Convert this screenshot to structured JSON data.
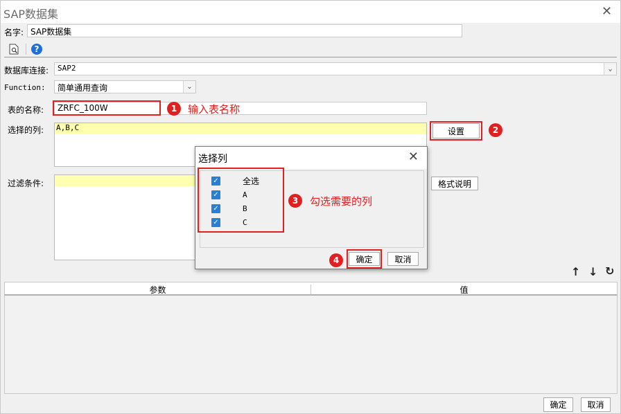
{
  "window": {
    "title": "SAP数据集"
  },
  "name_row": {
    "label": "名字:",
    "value": "SAP数据集"
  },
  "toolbar": {
    "preview_icon": "preview-icon",
    "help_icon": "help-icon"
  },
  "db_connection": {
    "label": "数据库连接:",
    "value": "SAP2"
  },
  "function": {
    "label": "Function:",
    "value": "简单通用查询"
  },
  "table_name": {
    "label": "表的名称:",
    "value": "ZRFC_100W"
  },
  "selected_columns": {
    "label": "选择的列:",
    "value": "A,B,C",
    "settings_button": "设置"
  },
  "filter": {
    "label": "过滤条件:",
    "format_button": "格式说明"
  },
  "annotations": {
    "a1": {
      "num": "1",
      "text": "输入表名称"
    },
    "a2": {
      "num": "2"
    },
    "a3": {
      "num": "3",
      "text": "勾选需要的列"
    },
    "a4": {
      "num": "4"
    }
  },
  "dialog": {
    "title": "选择列",
    "items": [
      {
        "label": "全选",
        "checked": true
      },
      {
        "label": "A",
        "checked": true
      },
      {
        "label": "B",
        "checked": true
      },
      {
        "label": "C",
        "checked": true
      }
    ],
    "ok": "确定",
    "cancel": "取消"
  },
  "params_table": {
    "col1": "参数",
    "col2": "值"
  },
  "footer": {
    "ok": "确定",
    "cancel": "取消"
  },
  "colors": {
    "annotation": "#e02020",
    "checkbox": "#2a7fd4",
    "highlight": "#ffffb0"
  }
}
